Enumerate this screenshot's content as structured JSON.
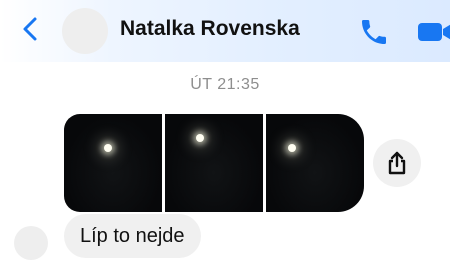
{
  "header": {
    "contact_name": "Natalka Rovenska",
    "accent_color": "#1877f2",
    "icons": [
      "chevron-left-icon",
      "phone-icon",
      "video-camera-icon"
    ]
  },
  "thread": {
    "timestamp": "ÚT 21:35",
    "photos": [
      {
        "label": "moon-photo-1"
      },
      {
        "label": "moon-photo-2"
      },
      {
        "label": "moon-photo-3"
      }
    ],
    "share_icon": "share-icon",
    "messages": [
      {
        "text": "Líp to nejde",
        "sender": "contact"
      }
    ]
  }
}
